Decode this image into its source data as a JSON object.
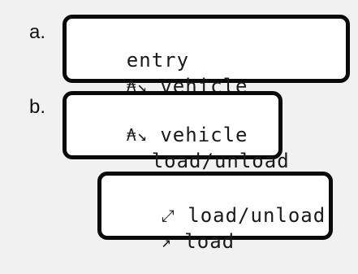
{
  "steps": [
    {
      "label": "a.",
      "display": {
        "line1": {
          "text": "entry"
        },
        "line2": {
          "icon": "vehicle-location-icon",
          "glyph": "₳↘",
          "text": " vehicle"
        }
      }
    },
    {
      "label": "b.",
      "display": {
        "line1": {
          "icon": "vehicle-location-icon",
          "glyph": "₳↘",
          "text": " vehicle"
        },
        "line2": {
          "text": "  load/unload"
        }
      }
    },
    {
      "label": "",
      "display": {
        "line1": {
          "icon": "load-unload-arrows-icon",
          "glyph": "⤢",
          "text": " load/unload"
        },
        "line2": {
          "icon": "load-arrow-icon",
          "glyph": "↗",
          "text": " load"
        }
      }
    }
  ]
}
